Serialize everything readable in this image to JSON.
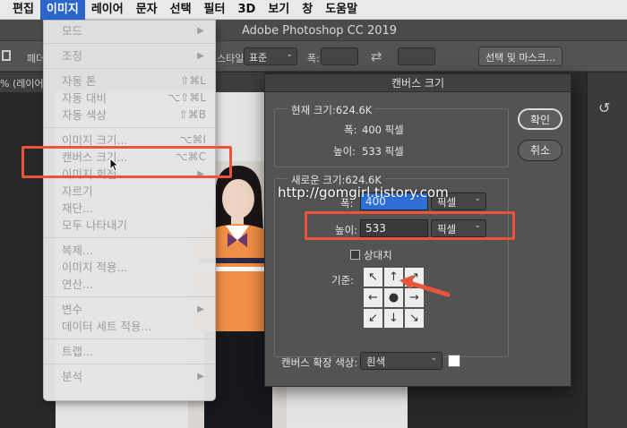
{
  "menubar": {
    "items": [
      "편집",
      "이미지",
      "레이어",
      "문자",
      "선택",
      "필터",
      "3D",
      "보기",
      "창",
      "도움말"
    ],
    "active_index": 1
  },
  "app": {
    "title": "Adobe Photoshop CC 2019"
  },
  "optbar": {
    "style_label": "스타일:",
    "style_value": "표준",
    "width_label": "폭:",
    "select_mask_button": "선택 및 마스크...",
    "left_fragment": "페더",
    "doc_tab_fragment": "% (레이어"
  },
  "image_menu": {
    "items": [
      {
        "label": "모드",
        "shortcut": "",
        "submenu": true
      },
      {
        "sep": true
      },
      {
        "label": "조정",
        "shortcut": "",
        "submenu": true
      },
      {
        "sep": true
      },
      {
        "label": "자동 톤",
        "shortcut": "⇧⌘L",
        "submenu": false
      },
      {
        "label": "자동 대비",
        "shortcut": "⌥⇧⌘L",
        "submenu": false
      },
      {
        "label": "자동 색상",
        "shortcut": "⇧⌘B",
        "submenu": false
      },
      {
        "sep": true
      },
      {
        "label": "이미지 크기...",
        "shortcut": "⌥⌘I",
        "submenu": false
      },
      {
        "label": "캔버스 크기...",
        "shortcut": "⌥⌘C",
        "submenu": false
      },
      {
        "label": "이미지 회전",
        "shortcut": "",
        "submenu": true
      },
      {
        "label": "자르기",
        "shortcut": "",
        "submenu": false
      },
      {
        "label": "재단...",
        "shortcut": "",
        "submenu": false
      },
      {
        "label": "모두 나타내기",
        "shortcut": "",
        "submenu": false
      },
      {
        "sep": true
      },
      {
        "label": "복제...",
        "shortcut": "",
        "submenu": false
      },
      {
        "label": "이미지 적용...",
        "shortcut": "",
        "submenu": false
      },
      {
        "label": "연산...",
        "shortcut": "",
        "submenu": false
      },
      {
        "sep": true
      },
      {
        "label": "변수",
        "shortcut": "",
        "submenu": true
      },
      {
        "label": "데이터 세트 적용...",
        "shortcut": "",
        "submenu": false
      },
      {
        "sep": true
      },
      {
        "label": "트랩...",
        "shortcut": "",
        "submenu": false
      },
      {
        "sep": true
      },
      {
        "label": "분석",
        "shortcut": "",
        "submenu": true
      }
    ]
  },
  "dialog": {
    "title": "캔버스 크기",
    "current_size_label": "현재 크기:624.6K",
    "current_width_label": "폭:",
    "current_width_value": "400 픽셀",
    "current_height_label": "높이:",
    "current_height_value": "533 픽셀",
    "new_size_label": "새로운 크기:624.6K",
    "width_label": "폭:",
    "width_value": "400",
    "height_label": "높이:",
    "height_value": "533",
    "unit": "픽셀",
    "relative_label": "상대치",
    "anchor_label": "기준:",
    "anchor_cells": [
      "↖",
      "↑",
      "↗",
      "←",
      "●",
      "→",
      "↙",
      "↓",
      "↘"
    ],
    "ext_color_label": "캔버스 확장 색상:",
    "ext_color_value": "흰색",
    "ok_button": "확인",
    "cancel_button": "취소"
  },
  "watermark": "http://gomgirl.tistory.com",
  "colors": {
    "highlight": "#e8553b",
    "menu_active": "#2a66c9",
    "dialog_bg": "#535353"
  }
}
